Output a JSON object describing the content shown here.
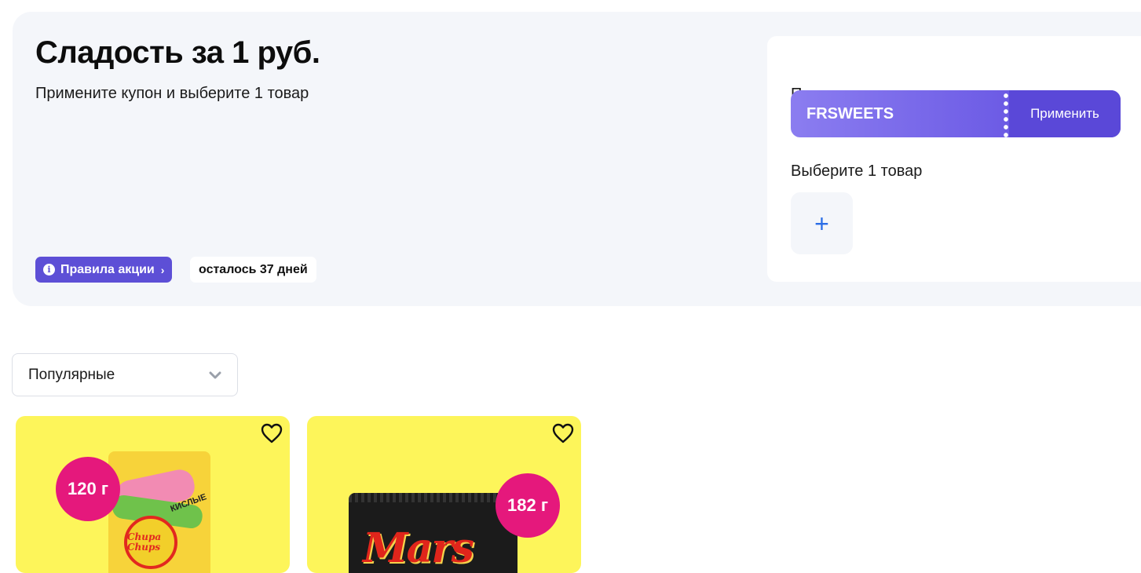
{
  "promo": {
    "title": "Сладость за 1 руб.",
    "subtitle": "Примените купон и выберите 1 товар",
    "rules_label": "Правила акции",
    "days_left": "осталось 37 дней"
  },
  "coupon": {
    "apply_label": "Примените купон",
    "code": "FRSWEETS",
    "apply_button": "Применить",
    "choose_label": "Выберите 1 товар",
    "add_symbol": "+"
  },
  "sort": {
    "selected": "Популярные"
  },
  "products": [
    {
      "weight": "120 г",
      "brand": "Chupa Chups",
      "side_text": "КИСЛЫЕ"
    },
    {
      "weight": "182 г",
      "brand": "Mars"
    }
  ],
  "colors": {
    "accent": "#5d4fd6",
    "panel": "#f4f6fa",
    "card": "#fdf55a",
    "badge": "#e5187c",
    "plus": "#2a6de6"
  },
  "icons": [
    "info-icon",
    "chevron-right-icon",
    "plus-icon",
    "chevron-down-icon",
    "heart-icon"
  ]
}
